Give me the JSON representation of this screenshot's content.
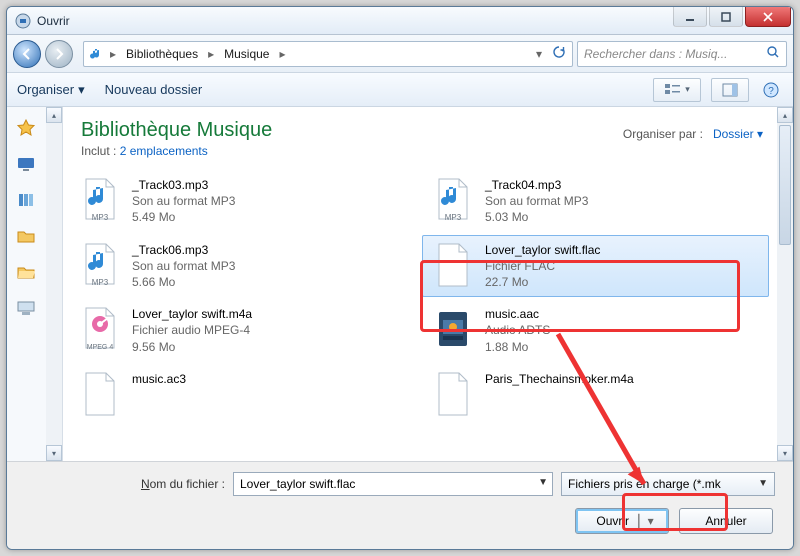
{
  "window": {
    "title": "Ouvrir"
  },
  "nav": {
    "breadcrumb": {
      "lib": "Bibliothèques",
      "folder": "Musique"
    },
    "search_placeholder": "Rechercher dans : Musiq..."
  },
  "toolbar": {
    "organize": "Organiser",
    "new_folder": "Nouveau dossier"
  },
  "library": {
    "title": "Bibliothèque Musique",
    "includes_prefix": "Inclut :",
    "includes_link": "2 emplacements",
    "arrange_label": "Organiser par :",
    "arrange_value": "Dossier"
  },
  "files": [
    {
      "name": "_Track03.mp3",
      "type": "Son au format MP3",
      "size": "5.49 Mo",
      "icon": "mp3"
    },
    {
      "name": "_Track04.mp3",
      "type": "Son au format MP3",
      "size": "5.03 Mo",
      "icon": "mp3"
    },
    {
      "name": "_Track06.mp3",
      "type": "Son au format MP3",
      "size": "5.66 Mo",
      "icon": "mp3"
    },
    {
      "name": "Lover_taylor swift.flac",
      "type": "Fichier FLAC",
      "size": "22.7 Mo",
      "icon": "blank",
      "selected": true
    },
    {
      "name": "Lover_taylor swift.m4a",
      "type": "Fichier audio MPEG-4",
      "size": "9.56 Mo",
      "icon": "m4a"
    },
    {
      "name": "music.aac",
      "type": "Audio ADTS",
      "size": "1.88 Mo",
      "icon": "aac"
    },
    {
      "name": "music.ac3",
      "type": "",
      "size": "",
      "icon": "blank"
    },
    {
      "name": "Paris_Thechainsmoker.m4a",
      "type": "",
      "size": "",
      "icon": "blank"
    }
  ],
  "footer": {
    "filename_label_pre": "N",
    "filename_label_post": "om du fichier :",
    "filename_value": "Lover_taylor swift.flac",
    "filetype_value": "Fichiers pris en charge (*.mk",
    "open": "Ouvrir",
    "cancel": "Annuler"
  }
}
